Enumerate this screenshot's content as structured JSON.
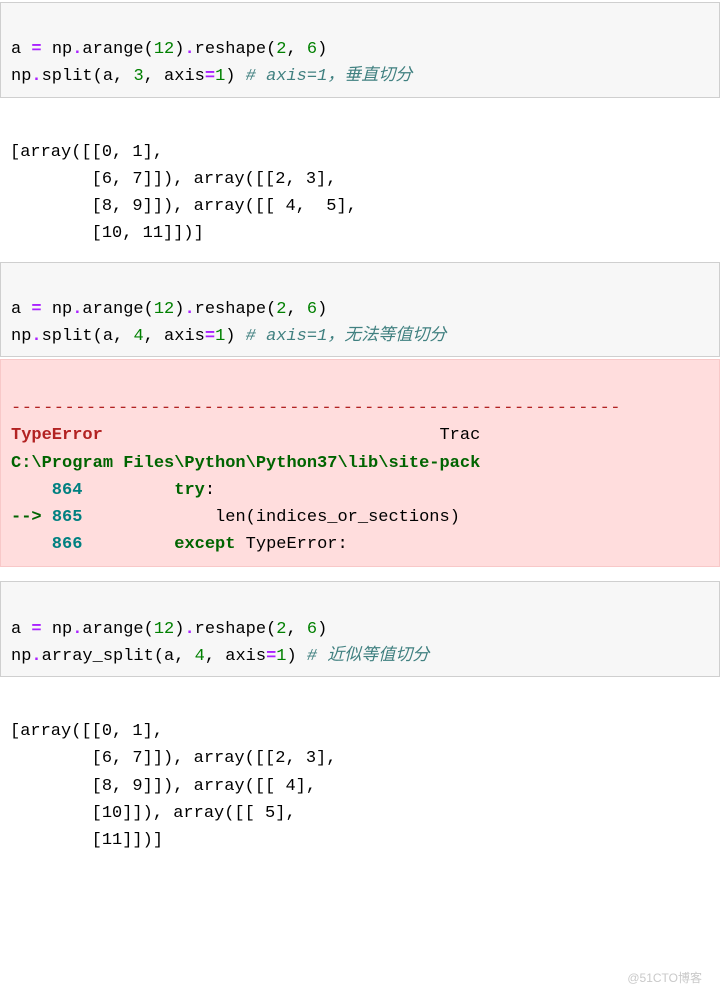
{
  "cell1": {
    "line1": {
      "a": "a",
      "eq": " = ",
      "np": "np",
      "dot1": ".",
      "arange": "arange",
      "paren_open": "(",
      "n12": "12",
      "paren_close": ")",
      "dot2": ".",
      "reshape": "reshape",
      "paren_open2": "(",
      "n2": "2",
      "comma": ", ",
      "n6": "6",
      "paren_close2": ")"
    },
    "line2": {
      "np": "np",
      "dot": ".",
      "split": "split",
      "popen": "(",
      "a": "a",
      "c1": ", ",
      "n3": "3",
      "c2": ", ",
      "axis": "axis",
      "eq": "=",
      "n1": "1",
      "pclose": ") ",
      "comment": "# axis=1，垂直切分"
    }
  },
  "out1": {
    "l1": "[array([[0, 1],",
    "l2": "        [6, 7]]), array([[2, 3],",
    "l3": "        [8, 9]]), array([[ 4,  5],",
    "l4": "        [10, 11]])]"
  },
  "cell2": {
    "line1_same_as_cell1": true,
    "line2": {
      "np": "np",
      "dot": ".",
      "split": "split",
      "popen": "(",
      "a": "a",
      "c1": ", ",
      "n4": "4",
      "c2": ", ",
      "axis": "axis",
      "eq": "=",
      "n1": "1",
      "pclose": ") ",
      "comment": "# axis=1，无法等值切分"
    }
  },
  "error": {
    "dashes": "---------------------------------------------------------",
    "type_error": "TypeError",
    "trac": "Trac",
    "path": "C:\\Program Files\\Python\\Python37\\lib\\site-pack",
    "l864": "    864",
    "l864_code_kw": "try",
    "l864_code_colon": ":",
    "arrow": "--> ",
    "l865": "865",
    "l865_code_pre": "            ",
    "l865_len": "len",
    "l865_open": "(",
    "l865_arg": "indices_or_sections",
    "l865_close": ")",
    "l866": "    866",
    "l866_code_kw1": "except",
    "l866_code_kw2": " TypeError",
    "l866_code_colon": ":"
  },
  "cell3": {
    "line2": {
      "np": "np",
      "dot": ".",
      "split": "array_split",
      "popen": "(",
      "a": "a",
      "c1": ", ",
      "n4": "4",
      "c2": ", ",
      "axis": "axis",
      "eq": "=",
      "n1": "1",
      "pclose": ") ",
      "comment": "# 近似等值切分"
    }
  },
  "out3": {
    "l1": "[array([[0, 1],",
    "l2": "        [6, 7]]), array([[2, 3],",
    "l3": "        [8, 9]]), array([[ 4],",
    "l4": "        [10]]), array([[ 5],",
    "l5": "        [11]])]"
  },
  "watermark": "@51CTO博客"
}
